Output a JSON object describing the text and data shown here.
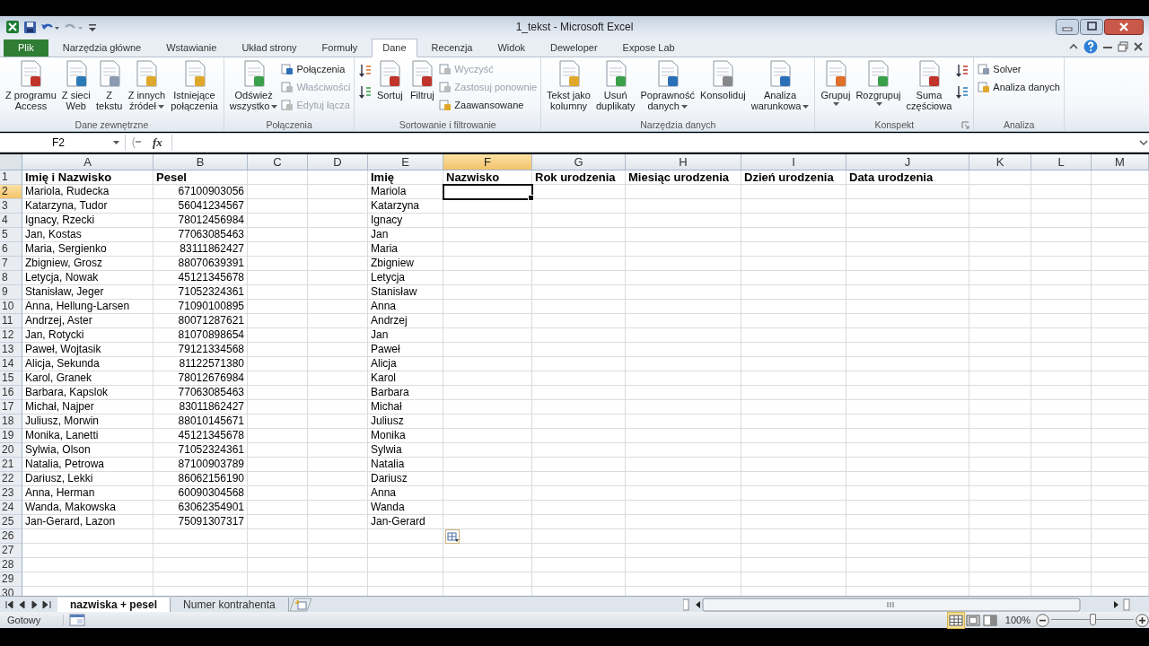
{
  "title_bar": {
    "title": "1_tekst - Microsoft Excel"
  },
  "tabs": [
    {
      "label": "Plik",
      "kind": "file",
      "selected": false
    },
    {
      "label": "Narzędzia główne",
      "kind": "tab",
      "selected": false
    },
    {
      "label": "Wstawianie",
      "kind": "tab",
      "selected": false
    },
    {
      "label": "Układ strony",
      "kind": "tab",
      "selected": false
    },
    {
      "label": "Formuły",
      "kind": "tab",
      "selected": false
    },
    {
      "label": "Dane",
      "kind": "tab",
      "selected": true
    },
    {
      "label": "Recenzja",
      "kind": "tab",
      "selected": false
    },
    {
      "label": "Widok",
      "kind": "tab",
      "selected": false
    },
    {
      "label": "Deweloper",
      "kind": "tab",
      "selected": false
    },
    {
      "label": "Expose Lab",
      "kind": "tab",
      "selected": false
    }
  ],
  "ribbon": [
    {
      "label": "Dane zewnętrzne",
      "launcher": false,
      "items": [
        {
          "kind": "large",
          "label": "Z programu\nAccess",
          "disabled": false
        },
        {
          "kind": "large",
          "label": "Z sieci\nWeb",
          "disabled": false
        },
        {
          "kind": "large",
          "label": "Z\ntekstu",
          "disabled": false
        },
        {
          "kind": "large",
          "label": "Z innych\nźródeł",
          "disabled": false,
          "dropdown_inline": true
        },
        {
          "kind": "large",
          "label": "Istniejące\npołączenia",
          "disabled": false
        }
      ]
    },
    {
      "label": "Połączenia",
      "launcher": false,
      "items": [
        {
          "kind": "large",
          "label": "Odśwież\nwszystko",
          "disabled": false,
          "dropdown_inline": true
        },
        {
          "kind": "small",
          "label": "Połączenia",
          "disabled": false
        },
        {
          "kind": "small",
          "label": "Właściwości",
          "disabled": true
        },
        {
          "kind": "small",
          "label": "Edytuj łącza",
          "disabled": true
        }
      ]
    },
    {
      "label": "Sortowanie i filtrowanie",
      "launcher": false,
      "items": [
        {
          "kind": "icon",
          "disabled": false
        },
        {
          "kind": "icon",
          "disabled": false
        },
        {
          "kind": "large",
          "label": "Sortuj",
          "disabled": false
        },
        {
          "kind": "large",
          "label": "Filtruj",
          "disabled": false
        },
        {
          "kind": "small",
          "label": "Wyczyść",
          "disabled": true
        },
        {
          "kind": "small",
          "label": "Zastosuj ponownie",
          "disabled": true
        },
        {
          "kind": "small",
          "label": "Zaawansowane",
          "disabled": false
        }
      ]
    },
    {
      "label": "Narzędzia danych",
      "launcher": false,
      "items": [
        {
          "kind": "large",
          "label": "Tekst jako\nkolumny",
          "disabled": false
        },
        {
          "kind": "large",
          "label": "Usuń\nduplikaty",
          "disabled": false
        },
        {
          "kind": "large",
          "label": "Poprawność\ndanych",
          "disabled": false,
          "dropdown_inline": true
        },
        {
          "kind": "large",
          "label": "Konsoliduj",
          "disabled": false
        },
        {
          "kind": "large",
          "label": "Analiza\nwarunkowa",
          "disabled": false,
          "dropdown_inline": true
        }
      ]
    },
    {
      "label": "Konspekt",
      "launcher": true,
      "items": [
        {
          "kind": "large",
          "label": "Grupuj",
          "disabled": false,
          "dropdown_below": true
        },
        {
          "kind": "large",
          "label": "Rozgrupuj",
          "disabled": false,
          "dropdown_below": true
        },
        {
          "kind": "large",
          "label": "Suma\nczęściowa",
          "disabled": false
        },
        {
          "kind": "icon",
          "disabled": false
        },
        {
          "kind": "icon",
          "disabled": false
        }
      ]
    },
    {
      "label": "Analiza",
      "launcher": false,
      "items": [
        {
          "kind": "small",
          "label": "Solver",
          "disabled": false
        },
        {
          "kind": "small",
          "label": "Analiza danych",
          "disabled": false
        }
      ]
    }
  ],
  "formula_bar": {
    "name_box": "F2",
    "function_label": "fx"
  },
  "sheet": {
    "fill_options_button": true,
    "columns": [
      {
        "label": "A",
        "selected": false
      },
      {
        "label": "B",
        "selected": false,
        "numeric": true
      },
      {
        "label": "C",
        "selected": false
      },
      {
        "label": "D",
        "selected": false
      },
      {
        "label": "E",
        "selected": false
      },
      {
        "label": "F",
        "selected": true
      },
      {
        "label": "G",
        "selected": false
      },
      {
        "label": "H",
        "selected": false
      },
      {
        "label": "I",
        "selected": false
      },
      {
        "label": "J",
        "selected": false
      },
      {
        "label": "K",
        "selected": false
      },
      {
        "label": "L",
        "selected": false
      },
      {
        "label": "M",
        "selected": false
      }
    ],
    "rows": [
      {
        "number": "1",
        "selected": false,
        "kind": "header",
        "cells": {
          "A": "Imię i Nazwisko",
          "B": "Pesel",
          "E": "Imię",
          "F": "Nazwisko",
          "G": "Rok urodzenia",
          "H": "Miesiąc urodzenia",
          "I": "Dzień urodzenia",
          "J": "Data urodzenia"
        }
      },
      {
        "number": "2",
        "selected": true,
        "cells": {
          "A": "Mariola, Rudecka",
          "B": "67100903056",
          "E": "Mariola"
        }
      },
      {
        "number": "3",
        "selected": false,
        "cells": {
          "A": "Katarzyna, Tudor",
          "B": "56041234567",
          "E": "Katarzyna"
        }
      },
      {
        "number": "4",
        "selected": false,
        "cells": {
          "A": "Ignacy, Rzecki",
          "B": "78012456984",
          "E": "Ignacy"
        }
      },
      {
        "number": "5",
        "selected": false,
        "cells": {
          "A": "Jan, Kostas",
          "B": "77063085463",
          "E": "Jan"
        }
      },
      {
        "number": "6",
        "selected": false,
        "cells": {
          "A": "Maria, Sergienko",
          "B": "83111862427",
          "E": "Maria"
        }
      },
      {
        "number": "7",
        "selected": false,
        "cells": {
          "A": "Zbigniew, Grosz",
          "B": "88070639391",
          "E": "Zbigniew"
        }
      },
      {
        "number": "8",
        "selected": false,
        "cells": {
          "A": "Letycja, Nowak",
          "B": "45121345678",
          "E": "Letycja"
        }
      },
      {
        "number": "9",
        "selected": false,
        "cells": {
          "A": "Stanisław, Jeger",
          "B": "71052324361",
          "E": "Stanisław"
        }
      },
      {
        "number": "10",
        "selected": false,
        "cells": {
          "A": "Anna, Hellung-Larsen",
          "B": "71090100895",
          "E": "Anna"
        }
      },
      {
        "number": "11",
        "selected": false,
        "cells": {
          "A": "Andrzej, Aster",
          "B": "80071287621",
          "E": "Andrzej"
        }
      },
      {
        "number": "12",
        "selected": false,
        "cells": {
          "A": "Jan, Rotycki",
          "B": "81070898654",
          "E": "Jan"
        }
      },
      {
        "number": "13",
        "selected": false,
        "cells": {
          "A": "Paweł, Wojtasik",
          "B": "79121334568",
          "E": "Paweł"
        }
      },
      {
        "number": "14",
        "selected": false,
        "cells": {
          "A": "Alicja, Sekunda",
          "B": "81122571380",
          "E": "Alicja"
        }
      },
      {
        "number": "15",
        "selected": false,
        "cells": {
          "A": "Karol, Granek",
          "B": "78012676984",
          "E": "Karol"
        }
      },
      {
        "number": "16",
        "selected": false,
        "cells": {
          "A": "Barbara, Kapslok",
          "B": "77063085463",
          "E": "Barbara"
        }
      },
      {
        "number": "17",
        "selected": false,
        "cells": {
          "A": "Michał, Najper",
          "B": "83011862427",
          "E": "Michał"
        }
      },
      {
        "number": "18",
        "selected": false,
        "cells": {
          "A": "Juliusz, Morwin",
          "B": "88010145671",
          "E": "Juliusz"
        }
      },
      {
        "number": "19",
        "selected": false,
        "cells": {
          "A": "Monika, Lanetti",
          "B": "45121345678",
          "E": "Monika"
        }
      },
      {
        "number": "20",
        "selected": false,
        "cells": {
          "A": "Sylwia, Olson",
          "B": "71052324361",
          "E": "Sylwia"
        }
      },
      {
        "number": "21",
        "selected": false,
        "cells": {
          "A": "Natalia, Petrowa",
          "B": "87100903789",
          "E": "Natalia"
        }
      },
      {
        "number": "22",
        "selected": false,
        "cells": {
          "A": "Dariusz, Lekki",
          "B": "86062156190",
          "E": "Dariusz"
        }
      },
      {
        "number": "23",
        "selected": false,
        "cells": {
          "A": "Anna, Herman",
          "B": "60090304568",
          "E": "Anna"
        }
      },
      {
        "number": "24",
        "selected": false,
        "cells": {
          "A": "Wanda, Makowska",
          "B": "63062354901",
          "E": "Wanda"
        }
      },
      {
        "number": "25",
        "selected": false,
        "cells": {
          "A": "Jan-Gerard, Lazon",
          "B": "75091307317",
          "E": "Jan-Gerard"
        }
      },
      {
        "number": "26",
        "selected": false,
        "cells": {}
      },
      {
        "number": "27",
        "selected": false,
        "cells": {}
      },
      {
        "number": "28",
        "selected": false,
        "cells": {}
      },
      {
        "number": "29",
        "selected": false,
        "cells": {}
      },
      {
        "number": "30",
        "selected": false,
        "cells": {}
      }
    ]
  },
  "sheet_tabs": [
    {
      "label": "nazwiska + pesel",
      "selected": true
    },
    {
      "label": "Numer kontrahenta",
      "selected": false
    }
  ],
  "status_bar": {
    "status": "Gotowy",
    "views": [
      {
        "selected": true
      },
      {
        "selected": false
      },
      {
        "selected": false
      }
    ],
    "zoom": "100%",
    "zoom_slider": {
      "level": 0.5
    }
  }
}
